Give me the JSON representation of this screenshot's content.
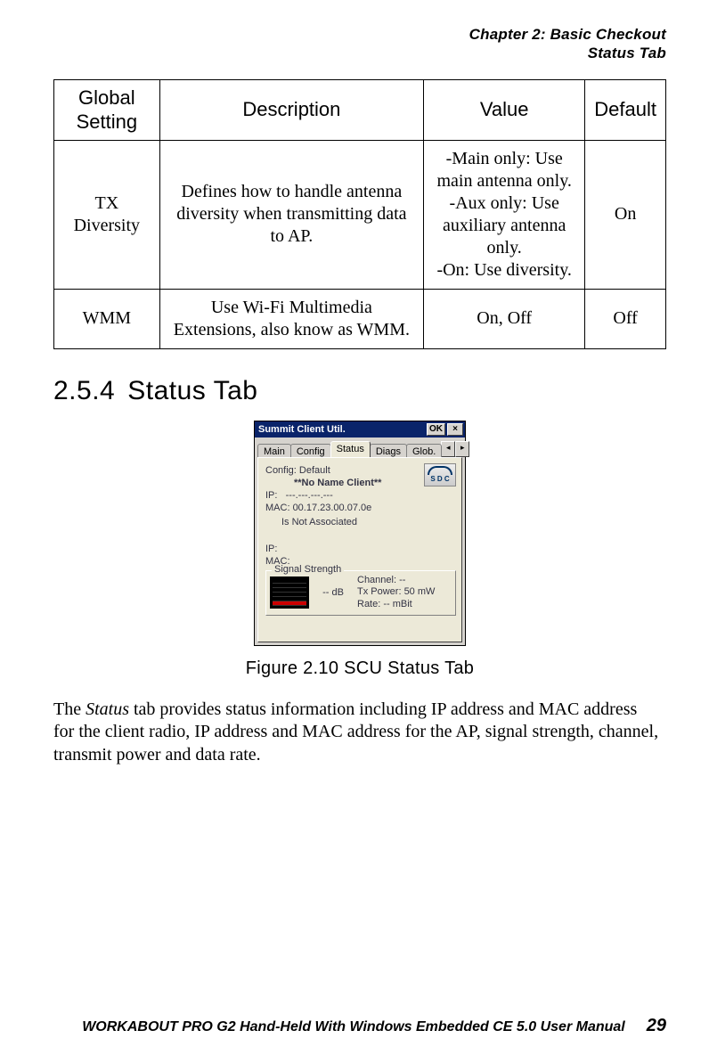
{
  "header": {
    "chapter": "Chapter 2: Basic Checkout",
    "section": "Status Tab"
  },
  "table": {
    "headers": [
      "Global Setting",
      "Description",
      "Value",
      "Default"
    ],
    "rows": [
      {
        "setting": "TX Diversity",
        "description": "Defines how to handle antenna diversity when transmitting data to AP.",
        "value": "-Main only: Use main antenna only.\n-Aux only: Use auxiliary antenna only.\n-On: Use diversity.",
        "default": "On"
      },
      {
        "setting": "WMM",
        "description": "Use Wi-Fi Multimedia Extensions, also know as WMM.",
        "value": "On, Off",
        "default": "Off"
      }
    ]
  },
  "section_heading": {
    "number": "2.5.4",
    "title": "Status Tab"
  },
  "screenshot": {
    "window_title": "Summit Client Util.",
    "ok_btn": "OK",
    "close_btn": "×",
    "tabs": [
      "Main",
      "Config",
      "Status",
      "Diags",
      "Glob."
    ],
    "active_tab_index": 2,
    "spin_left": "◂",
    "spin_right": "▸",
    "logo_text": "S D C",
    "lines": {
      "config": "Config: Default",
      "client_name": "**No Name Client**",
      "ip1_label": "IP:",
      "ip1_value": "---.---.---.---",
      "mac1_label": "MAC:",
      "mac1_value": "00.17.23.00.07.0e",
      "assoc": "Is Not Associated",
      "ip2_label": "IP:",
      "ip2_value": "",
      "mac2_label": "MAC:",
      "mac2_value": ""
    },
    "signal": {
      "legend": "Signal Strength",
      "db": "-- dB",
      "channel": "Channel: --",
      "txpower": "Tx Power: 50 mW",
      "rate": "Rate: -- mBit"
    }
  },
  "figure_caption": "Figure 2.10 SCU Status Tab",
  "body": {
    "para_prefix": "The ",
    "para_italic": "Status",
    "para_rest": " tab provides status information including IP address and MAC address for the client radio, IP address and MAC address for the AP, signal strength, channel, transmit power and data rate."
  },
  "footer": {
    "manual": "WORKABOUT PRO G2 Hand-Held With Windows Embedded CE 5.0 User Manual",
    "page": "29"
  }
}
